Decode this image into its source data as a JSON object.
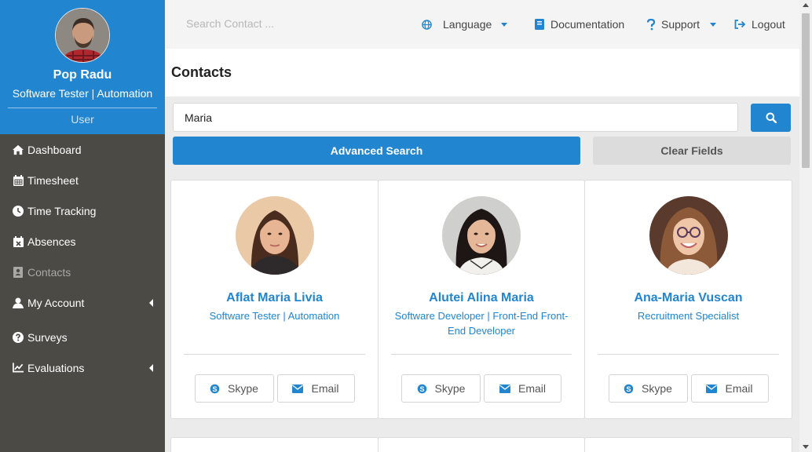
{
  "user": {
    "name": "Pop Radu",
    "role": "Software Tester | Automation",
    "type": "User"
  },
  "nav": [
    {
      "label": "Dashboard",
      "icon": "home-icon"
    },
    {
      "label": "Timesheet",
      "icon": "calendar-icon"
    },
    {
      "label": "Time Tracking",
      "icon": "clock-icon"
    },
    {
      "label": "Absences",
      "icon": "calendar-x-icon"
    },
    {
      "label": "Contacts",
      "icon": "contact-card-icon"
    },
    {
      "label": "My Account",
      "icon": "user-icon"
    },
    {
      "label": "Surveys",
      "icon": "question-circle-icon"
    },
    {
      "label": "Evaluations",
      "icon": "line-chart-icon"
    }
  ],
  "topbar": {
    "search_placeholder": "Search Contact ...",
    "language": "Language",
    "documentation": "Documentation",
    "support": "Support",
    "logout": "Logout"
  },
  "page": {
    "title": "Contacts",
    "search_value": "Maria",
    "advanced_search": "Advanced Search",
    "clear_fields": "Clear Fields"
  },
  "contacts": [
    {
      "name": "Aflat Maria Livia",
      "title": "Software Tester | Automation",
      "skype": "Skype",
      "email": "Email"
    },
    {
      "name": "Alutei Alina Maria",
      "title": "Software Developer | Front-End Front-End Developer",
      "skype": "Skype",
      "email": "Email"
    },
    {
      "name": "Ana-Maria Vuscan",
      "title": "Recruitment Specialist",
      "skype": "Skype",
      "email": "Email"
    }
  ],
  "colors": {
    "accent": "#2185d0",
    "sidebar": "#4b4a45",
    "background": "#ebebeb"
  }
}
